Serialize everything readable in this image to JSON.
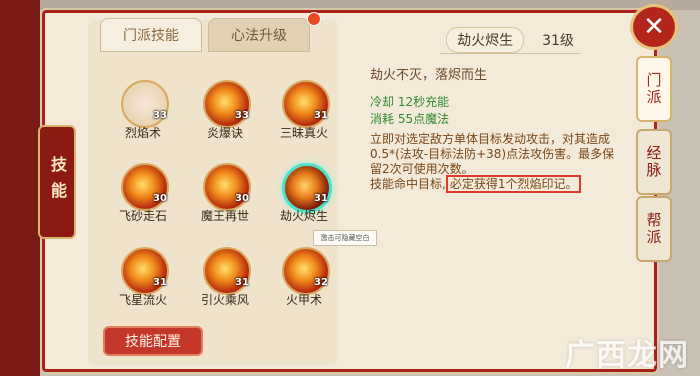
{
  "window": {
    "side_tab_label": "技能",
    "close_label": "✕"
  },
  "tabs": [
    {
      "label": "门派技能",
      "active": true
    },
    {
      "label": "心法升级",
      "active": false
    }
  ],
  "skills": [
    {
      "name": "烈焰术",
      "level": "33"
    },
    {
      "name": "炎爆诀",
      "level": "33"
    },
    {
      "name": "三昧真火",
      "level": "31"
    },
    {
      "name": "飞砂走石",
      "level": "30"
    },
    {
      "name": "魔王再世",
      "level": "30"
    },
    {
      "name": "劫火烬生",
      "level": "31"
    },
    {
      "name": "飞星流火",
      "level": "31"
    },
    {
      "name": "引火乘风",
      "level": "31"
    },
    {
      "name": "火甲术",
      "level": "32"
    }
  ],
  "tooltip": "激击可隐藏空白",
  "config_button": "技能配置",
  "detail": {
    "name": "劫火烬生",
    "level": "31级",
    "motto": "劫火不灭，落烬而生",
    "cooldown": "冷却 12秒充能",
    "cost": "消耗 55点魔法",
    "desc_main": "立即对选定敌方单体目标发动攻击，对其造成0.5*(法攻-目标法防+38)点法攻伤害。最多保留2次可使用次数。",
    "desc_tail_prefix": "技能命中目标,",
    "desc_highlight": "必定获得1个烈焰印记。"
  },
  "right_tabs": [
    {
      "label": "门派",
      "active": true
    },
    {
      "label": "经脉",
      "active": false
    },
    {
      "label": "帮派",
      "active": false
    }
  ],
  "watermark": "广西龙网"
}
